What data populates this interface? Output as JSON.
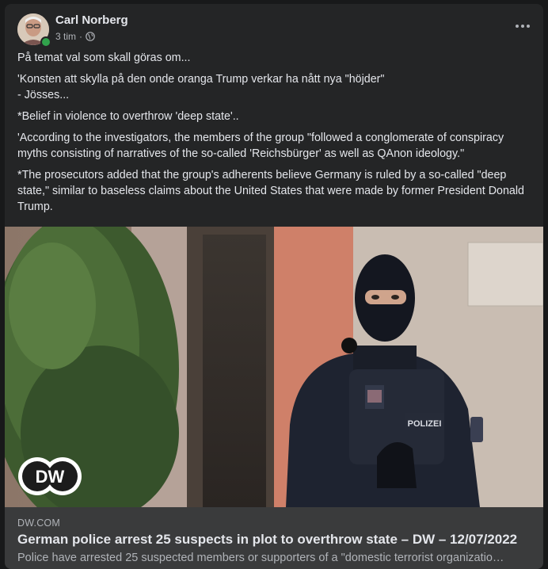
{
  "post": {
    "author": "Carl Norberg",
    "time": "3 tim",
    "separator": "·",
    "paragraphs": [
      "På temat val som skall göras om...",
      "'Konsten att skylla på den onde oranga Trump verkar ha nått nya \"höjder\"",
      "- Jösses...",
      "*Belief in violence to overthrow 'deep state'..",
      "'According to the investigators, the members of the group \"followed a conglomerate of conspiracy myths consisting of narratives of the so-called 'Reichsbürger' as well as QAnon ideology.\"",
      "*The prosecutors added that the group's adherents believe Germany is ruled by a so-called \"deep state,\" similar to baseless claims about the United States that were made by former President Donald Trump."
    ]
  },
  "photo": {
    "badge_text": "POLIZEI",
    "logo_text": "DW"
  },
  "link": {
    "domain": "DW.COM",
    "title": "German police arrest 25 suspects in plot to overthrow state – DW – 12/07/2022",
    "description": "Police have arrested 25 suspected members or supporters of a \"domestic terrorist organizatio…"
  },
  "colors": {
    "background": "#18191a",
    "card": "#242526",
    "link_box": "#3a3b3c",
    "online": "#31a24c"
  }
}
